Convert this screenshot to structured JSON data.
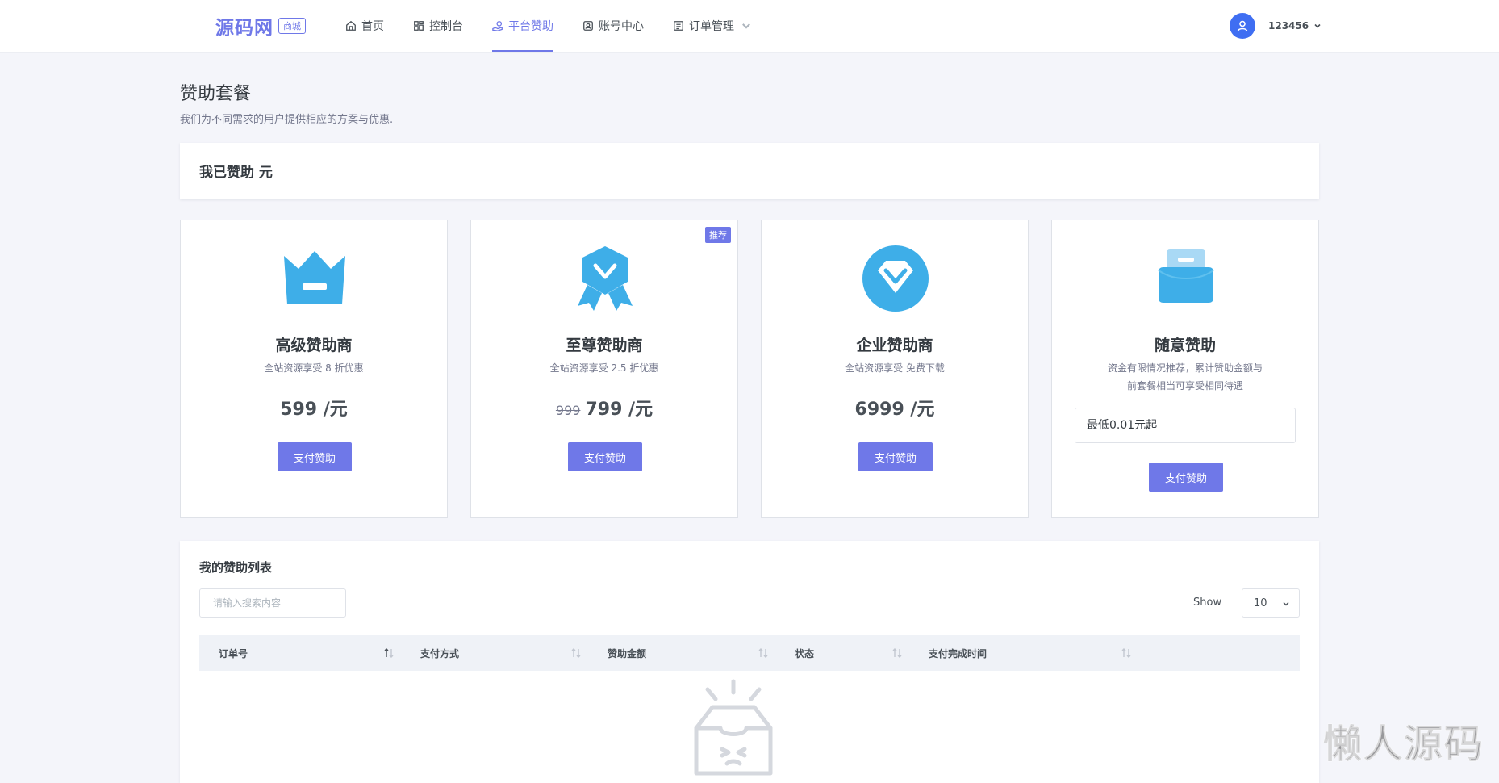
{
  "brand": {
    "name": "源码网",
    "badge": "商城"
  },
  "nav": {
    "items": [
      {
        "label": "首页",
        "icon": "home-icon"
      },
      {
        "label": "控制台",
        "icon": "dashboard-icon"
      },
      {
        "label": "平台赞助",
        "icon": "sponsor-icon",
        "active": true
      },
      {
        "label": "账号中心",
        "icon": "account-icon"
      },
      {
        "label": "订单管理",
        "icon": "order-icon",
        "dropdown": true
      }
    ]
  },
  "user": {
    "name": "123456"
  },
  "page": {
    "title": "赞助套餐",
    "subtitle": "我们为不同需求的用户提供相应的方案与优惠."
  },
  "sponsored": {
    "text": "我已赞助 元"
  },
  "plans": [
    {
      "name": "高级赞助商",
      "desc": "全站资源享受 8 折优惠",
      "price": "599 /元",
      "button": "支付赞助",
      "icon": "crown-icon"
    },
    {
      "name": "至尊赞助商",
      "desc": "全站资源享受 2.5 折优惠",
      "old_price": "999",
      "price": "799 /元",
      "button": "支付赞助",
      "badge": "推荐",
      "icon": "ribbon-badge-icon"
    },
    {
      "name": "企业赞助商",
      "desc": "全站资源享受 免费下载",
      "price": "6999 /元",
      "button": "支付赞助",
      "icon": "diamond-icon"
    },
    {
      "name": "随意赞助",
      "desc_line1": "资金有限情况推荐，累计赞助金额与",
      "desc_line2": "前套餐相当可享受相同待遇",
      "input_placeholder": "最低0.01元起",
      "button": "支付赞助",
      "icon": "wallet-icon"
    }
  ],
  "list": {
    "title": "我的赞助列表",
    "search_placeholder": "请输入搜索内容",
    "show_label": "Show",
    "page_size": "10",
    "columns": [
      "订单号",
      "支付方式",
      "赞助金额",
      "状态",
      "支付完成时间"
    ]
  },
  "watermark": "懒人源码",
  "colors": {
    "primary": "#6f78e8",
    "icon_blue": "#3eaee8",
    "avatar": "#3f6ef2"
  }
}
